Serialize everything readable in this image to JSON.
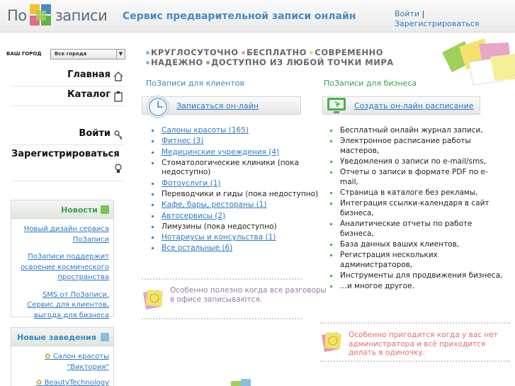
{
  "header": {
    "logo_left": "По",
    "logo_right": "записи",
    "service_title": "Сервис предварительной записи онлайн",
    "login": "Войти",
    "separator": "|",
    "register": "Зарегистрироваться"
  },
  "city": {
    "label": "ВАШ ГОРОД",
    "selected": "Все города",
    "arrow": "▼"
  },
  "nav": {
    "main": "Главная",
    "catalog": "Каталог",
    "login": "Войти",
    "register": "Зарегистрироваться"
  },
  "news": {
    "title": "Новости",
    "items": [
      "Новый дизайн сервиса ПоЗаписи",
      "ПоЗаписи поддержит освоение космического пространства",
      "SMS от ПоЗаписи. Сервис для клиентов, выгода для бизнеса"
    ]
  },
  "new_places": {
    "title": "Новые заведения",
    "items": [
      "Салон красоты \"Виктория\"",
      "BeautyTechnology"
    ]
  },
  "taglines": {
    "line1": [
      "КРУГЛОСУТОЧНО",
      "БЕСПЛАТНО",
      "СОВРЕМЕННО"
    ],
    "line2": [
      "НАДЕЖНО",
      "ДОСТУПНО ИЗ ЛЮБОЙ ТОЧКИ МИРА"
    ]
  },
  "clients": {
    "title": "ПоЗаписи для клиентов",
    "action": "Записаться он-лайн",
    "items": [
      {
        "text": "Салоны красоты (165)",
        "link": true
      },
      {
        "text": "Фитнес (3)",
        "link": true
      },
      {
        "text": "Медицинские учреждения (4)",
        "link": true
      },
      {
        "text": "Стоматологические клиники (пока недоступно)",
        "link": false
      },
      {
        "text": "Фотоуслуги (1)",
        "link": true
      },
      {
        "text": "Переводчики и гиды (пока недоступно)",
        "link": false
      },
      {
        "text": "Кафе, бары, рестораны (1)",
        "link": true
      },
      {
        "text": "Автосервисы (2)",
        "link": true
      },
      {
        "text": "Лимузины (пока недоступно)",
        "link": false
      },
      {
        "text": "Нотариусы и консульства (1)",
        "link": true
      },
      {
        "text": "Все остальные (6)",
        "link": true
      }
    ],
    "note": "Особенно полезно когда все разговоры в офисе записываются."
  },
  "business": {
    "title": "ПоЗаписи для бизнеса",
    "action": "Создать он-лайн расписание",
    "items": [
      "Бесплатный онлайн журнал записи,",
      "Электронное расписание работы мастеров,",
      "Уведомления о записи по e-mail/sms,",
      "Отчеты о записи в формате PDF по e-mail,",
      "Страница в каталоге без рекламы,",
      "Интеграция ссылки-календаря в сайт бизнеса,",
      "Аналитические отчеты по работе бизнеса,",
      "База данных ваших клиентов,",
      "Регистрация нескольких администраторов,",
      "Инструменты для продвижения бизнеса,",
      "...и многое другое."
    ],
    "note": "Особенно пригодится когда у вас нет администратора и всё приходится делать в одиночку."
  },
  "colors": {
    "accent_blue": "#3a8ac0",
    "link": "#2d78c8",
    "green": "#3aa34a",
    "note_client": "#9a7aa8",
    "note_business": "#e07070"
  }
}
